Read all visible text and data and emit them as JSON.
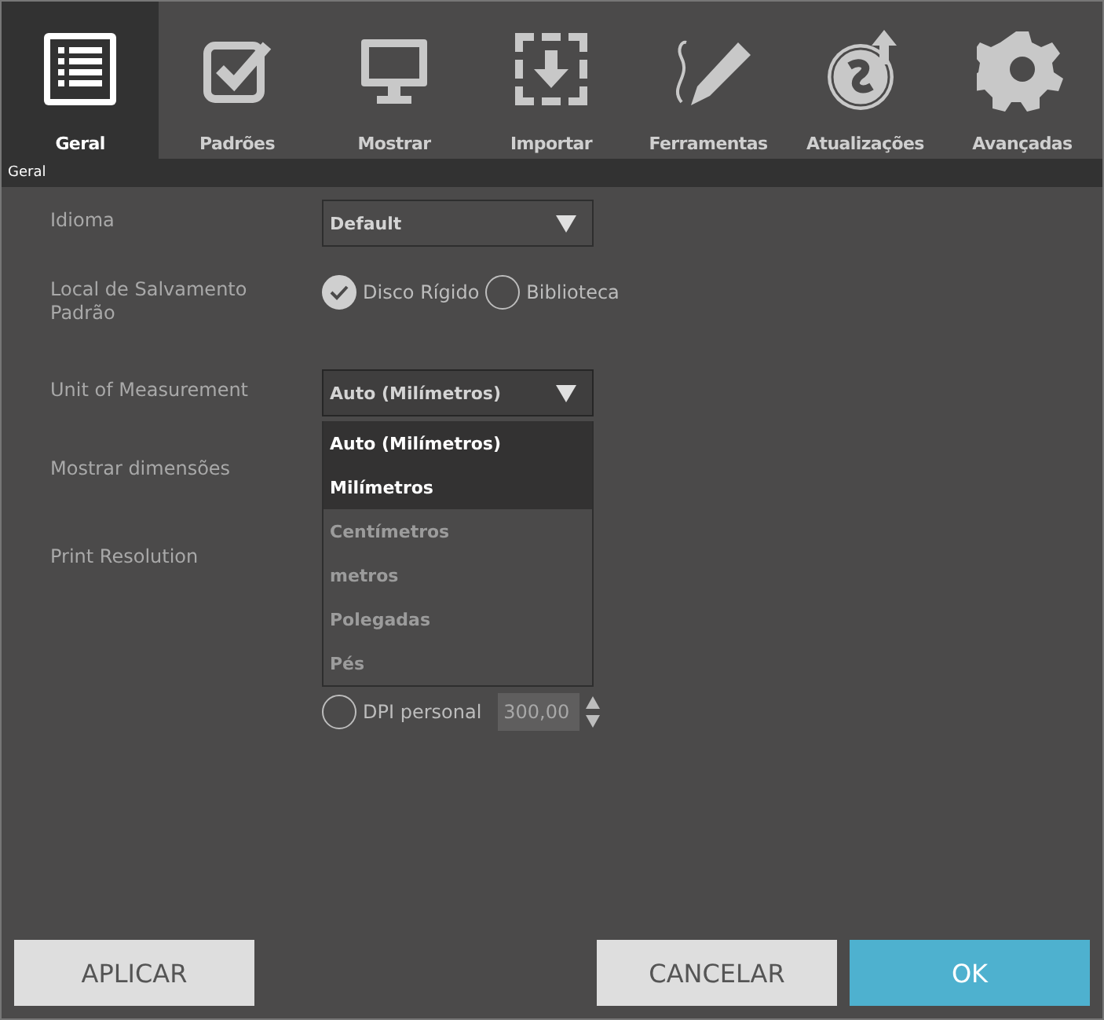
{
  "tabs": [
    {
      "label": "Geral",
      "selected": true
    },
    {
      "label": "Padrões",
      "selected": false
    },
    {
      "label": "Mostrar",
      "selected": false
    },
    {
      "label": "Importar",
      "selected": false
    },
    {
      "label": "Ferramentas",
      "selected": false
    },
    {
      "label": "Atualizações",
      "selected": false
    },
    {
      "label": "Avançadas",
      "selected": false
    }
  ],
  "section_title": "Geral",
  "settings": {
    "language": {
      "label": "Idioma",
      "value": "Default"
    },
    "save_location": {
      "label": "Local de Salvamento Padrão",
      "options": [
        {
          "label": "Disco Rígido",
          "selected": true
        },
        {
          "label": "Biblioteca",
          "selected": false
        }
      ]
    },
    "unit": {
      "label": "Unit of Measurement",
      "value": "Auto (Milímetros)",
      "expanded": true,
      "options": [
        {
          "label": "Auto (Milímetros)",
          "highlighted": true
        },
        {
          "label": "Milímetros",
          "highlighted": true
        },
        {
          "label": "Centímetros",
          "highlighted": false
        },
        {
          "label": "metros",
          "highlighted": false
        },
        {
          "label": "Polegadas",
          "highlighted": false
        },
        {
          "label": "Pés",
          "highlighted": false
        }
      ]
    },
    "show_dimensions": {
      "label": "Mostrar dimensões"
    },
    "print_resolution": {
      "label": "Print Resolution",
      "custom": {
        "label": "DPI personal",
        "selected": false,
        "value": "300,00",
        "disabled": true
      }
    }
  },
  "buttons": {
    "apply": "APLICAR",
    "cancel": "CANCELAR",
    "ok": "OK"
  }
}
